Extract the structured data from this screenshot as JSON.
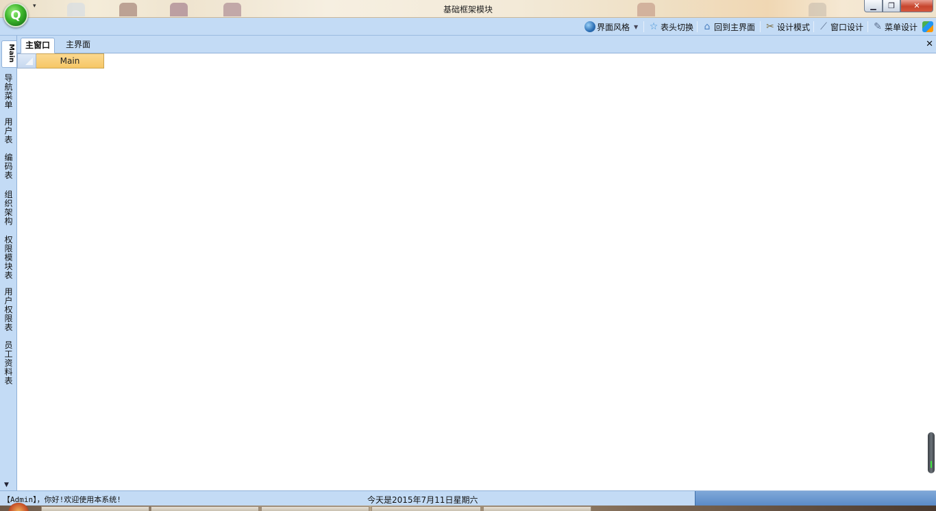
{
  "window": {
    "title": "基础框架模块",
    "minimize_glyph": "▁",
    "maximize_glyph": "❐",
    "close_glyph": "✕",
    "app_orb_glyph": "Q",
    "qat_glyph": "▾"
  },
  "toolbar": {
    "items": [
      {
        "label": "界面风格",
        "icon": "globe-icon",
        "dropdown": true
      },
      {
        "label": "表头切换",
        "icon": "star-icon"
      },
      {
        "label": "回到主界面",
        "icon": "home-icon"
      },
      {
        "label": "设计模式",
        "icon": "tools-icon"
      },
      {
        "label": "窗口设计",
        "icon": "window-design-icon"
      },
      {
        "label": "菜单设计",
        "icon": "edit-icon"
      }
    ],
    "dropdown_glyph": "▼",
    "star_glyph": "☆",
    "home_glyph": "⌂",
    "tools_glyph": "✂",
    "window_glyph": "⟋",
    "edit_glyph": "✎",
    "users_icon": "users-icon"
  },
  "nav": {
    "active": "Main",
    "items": [
      "导航菜单",
      "用户表",
      "编码表",
      "组织架构",
      "权限模块表",
      "用户权限表",
      "员工资料表"
    ],
    "scroll_glyph": "▼"
  },
  "tabs": {
    "items": [
      "主窗口",
      "主界面"
    ],
    "active_index": 0,
    "close_glyph": "✕"
  },
  "grid": {
    "header": "Main"
  },
  "status": {
    "greeting": "【Admin】，你好!欢迎使用本系统!",
    "date": "今天是2015年7月11日星期六"
  },
  "colors": {
    "chrome_blue": "#c3dbf5",
    "grid_header": "#f6c766",
    "status_accent": "#5b8bc8"
  }
}
